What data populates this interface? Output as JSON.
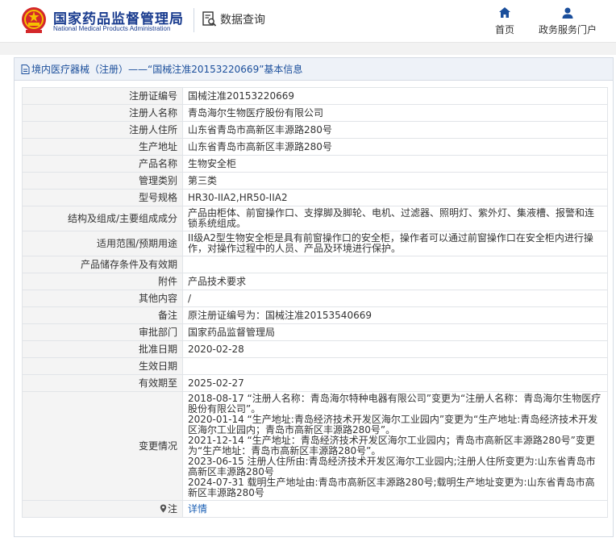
{
  "header": {
    "site_name": "国家药品监督管理局",
    "site_name_en": "National Medical Products Administration",
    "query_label": "数据查询",
    "nav": [
      {
        "label": "首页",
        "icon": "home-icon"
      },
      {
        "label": "政务服务门户",
        "icon": "user-icon"
      }
    ]
  },
  "panel": {
    "title": "境内医疗器械（注册）——“国械注准20153220669”基本信息"
  },
  "rows": [
    {
      "key": "注册证编号",
      "value": "国械注准20153220669"
    },
    {
      "key": "注册人名称",
      "value": "青岛海尔生物医疗股份有限公司"
    },
    {
      "key": "注册人住所",
      "value": "山东省青岛市高新区丰源路280号"
    },
    {
      "key": "生产地址",
      "value": "山东省青岛市高新区丰源路280号"
    },
    {
      "key": "产品名称",
      "value": "生物安全柜"
    },
    {
      "key": "管理类别",
      "value": "第三类"
    },
    {
      "key": "型号规格",
      "value": "HR30-IIA2,HR50-IIA2"
    },
    {
      "key": "结构及组成/主要组成成分",
      "value": "产品由柜体、前窗操作口、支撑脚及脚轮、电机、过滤器、照明灯、紫外灯、集液槽、报警和连锁系统组成。"
    },
    {
      "key": "适用范围/预期用途",
      "value": "II级A2型生物安全柜是具有前窗操作口的安全柜，操作者可以通过前窗操作口在安全柜内进行操作，对操作过程中的人员、产品及环境进行保护。"
    },
    {
      "key": "产品储存条件及有效期",
      "value": ""
    },
    {
      "key": "附件",
      "value": "产品技术要求"
    },
    {
      "key": "其他内容",
      "value": "/"
    },
    {
      "key": "备注",
      "value": "原注册证编号为：国械注准20153540669"
    },
    {
      "key": "审批部门",
      "value": "国家药品监督管理局"
    },
    {
      "key": "批准日期",
      "value": "2020-02-28"
    },
    {
      "key": "生效日期",
      "value": ""
    },
    {
      "key": "有效期至",
      "value": "2025-02-27"
    }
  ],
  "changes": {
    "key": "变更情况",
    "items": [
      "2018-08-17 “注册人名称：青岛海尔特种电器有限公司”变更为“注册人名称：青岛海尔生物医疗股份有限公司”。",
      "2020-01-14 “生产地址:青岛经济技术开发区海尔工业园内”变更为“生产地址:青岛经济技术开发区海尔工业园内；青岛市高新区丰源路280号”。",
      "2021-12-14 “生产地址：青岛经济技术开发区海尔工业园内；青岛市高新区丰源路280号”变更为“生产地址：青岛市高新区丰源路280号”。",
      "2023-06-15 注册人住所由:青岛经济技术开发区海尔工业园内;注册人住所变更为:山东省青岛市高新区丰源路280号",
      "2024-07-31 载明生产地址由:青岛市高新区丰源路280号;载明生产地址变更为:山东省青岛市高新区丰源路280号"
    ]
  },
  "note": {
    "key": "注",
    "link_label": "详情"
  },
  "colors": {
    "brand": "#1a3c8f",
    "title_text": "#1a4e9b",
    "link": "#1a5fb4",
    "key_bg": "#f4f4f4"
  }
}
